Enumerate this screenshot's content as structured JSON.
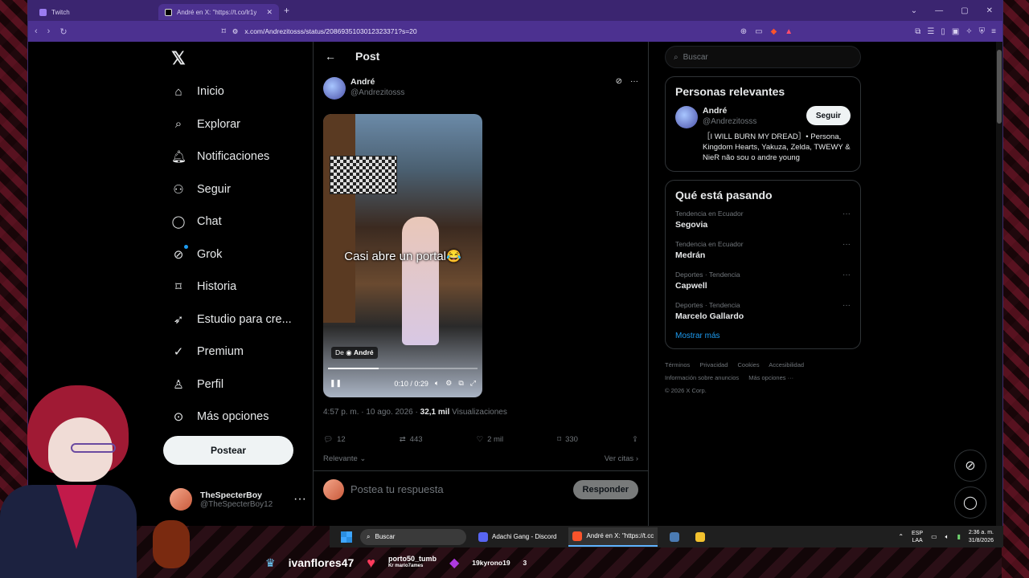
{
  "browser": {
    "tabs": [
      {
        "title": "Twitch"
      },
      {
        "title": "André en X: \"https://t.co/lr1y"
      }
    ],
    "url": "x.com/Andrezitosss/status/2086935103012323371?s=20"
  },
  "nav": {
    "items": [
      {
        "label": "Inicio",
        "icon": "home-icon"
      },
      {
        "label": "Explorar",
        "icon": "search-icon"
      },
      {
        "label": "Notificaciones",
        "icon": "bell-icon"
      },
      {
        "label": "Seguir",
        "icon": "add-person-icon"
      },
      {
        "label": "Chat",
        "icon": "chat-icon"
      },
      {
        "label": "Grok",
        "icon": "grok-icon"
      },
      {
        "label": "Historia",
        "icon": "bookmark-icon"
      },
      {
        "label": "Estudio para cre...",
        "icon": "rocket-icon"
      },
      {
        "label": "Premium",
        "icon": "verified-icon"
      },
      {
        "label": "Perfil",
        "icon": "person-icon"
      },
      {
        "label": "Más opciones",
        "icon": "more-circle-icon"
      }
    ],
    "post_label": "Postear",
    "account": {
      "name": "TheSpecterBoy",
      "handle": "@TheSpecterBoy12"
    }
  },
  "post": {
    "header": "Post",
    "author": {
      "name": "André",
      "handle": "@Andrezitosss"
    },
    "video": {
      "caption": "Casi abre un portal😂",
      "from_prefix": "De",
      "from_name": "André",
      "time": "0:10 / 0:29",
      "progress": 0.34
    },
    "timestamp": "4:57 p. m. · 10 ago. 2026 · ",
    "views": "32,1 mil",
    "views_label": " Visualizaciones",
    "stats": {
      "replies": "12",
      "reposts": "443",
      "likes": "2 mil",
      "bookmarks": "330"
    },
    "sort_label": "Relevante",
    "quotes_label": "Ver citas",
    "reply_placeholder": "Postea tu respuesta",
    "reply_button": "Responder"
  },
  "sidebar": {
    "search_placeholder": "Buscar",
    "relevant_title": "Personas relevantes",
    "relevant": {
      "name": "André",
      "handle": "@Andrezitosss",
      "follow_label": "Seguir",
      "bio": "［I WILL BURN MY DREAD］• Persona, Kingdom Hearts, Yakuza, Zelda, TWEWY & NieR não sou o andre young"
    },
    "trends_title": "Qué está pasando",
    "trends": [
      {
        "context": "Tendencia en Ecuador",
        "topic": "Segovia"
      },
      {
        "context": "Tendencia en Ecuador",
        "topic": "Medrán"
      },
      {
        "context": "Deportes · Tendencia",
        "topic": "Capwell"
      },
      {
        "context": "Deportes · Tendencia",
        "topic": "Marcelo Gallardo"
      }
    ],
    "show_more": "Mostrar más",
    "footer": [
      "Términos",
      "Privacidad",
      "Cookies",
      "Accesibilidad",
      "Información sobre anuncios",
      "Más opciones ···",
      "© 2026 X Corp."
    ]
  },
  "taskbar": {
    "search": "Buscar",
    "apps": [
      {
        "label": "Adachi Gang - Discord",
        "color": "#5865f2"
      },
      {
        "label": "André en X: \"https://t.cc",
        "color": "#fb542b"
      }
    ],
    "lang": [
      "ESP",
      "LAA"
    ],
    "time": "2:36 a. m.",
    "date": "31/8/2026"
  },
  "stream": {
    "subscriber": "ivanflores47",
    "donor_top": "porto50_tumb",
    "donor_bottom": "Kr mario7ames",
    "bits_user": "19kyrono19",
    "bits_count": "3"
  }
}
